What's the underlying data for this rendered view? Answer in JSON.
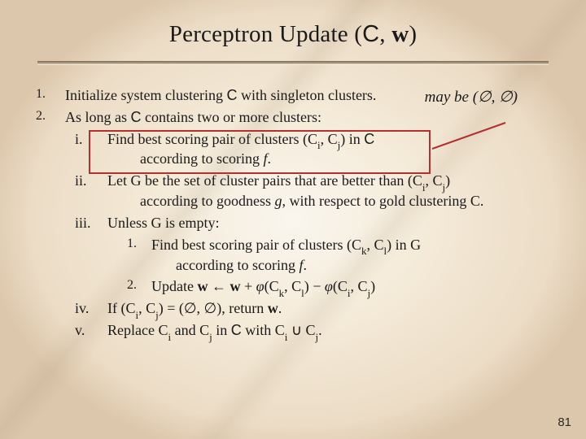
{
  "title_parts": {
    "pre": "Perceptron Update (",
    "C": "C",
    "mid": ", ",
    "w": "w",
    "post": ")"
  },
  "callout": "may be (∅, ∅)",
  "list": {
    "n1": "1.",
    "n2": "2.",
    "item1_a": "Initialize system clustering ",
    "item1_C": "C",
    "item1_b": " with singleton clusters.",
    "item2_a": "As long as ",
    "item2_C": "C",
    "item2_b": " contains two or more clusters:",
    "ri": "i.",
    "rii": "ii.",
    "riii": "iii.",
    "riv": "iv.",
    "rv": "v.",
    "i_a": "Find best scoring pair of clusters (C",
    "i_sub_i": "i",
    "i_mid": ", C",
    "i_sub_j": "j",
    "i_b": ") in ",
    "i_C": "C",
    "i_cont_a": "according to scoring ",
    "i_cont_f": "f",
    "i_cont_b": ".",
    "ii_a": "Let G be the set of cluster pairs that are better than (C",
    "ii_sub_i": "i",
    "ii_mid": ", C",
    "ii_sub_j": "j",
    "ii_b": ")",
    "ii_cont_a": "according to goodness ",
    "ii_cont_g": "g",
    "ii_cont_b": ", with respect to gold clustering C.",
    "iii_a": "Unless G is empty:",
    "in1": "1.",
    "in2": "2.",
    "iii1_a": "Find best scoring pair of clusters (C",
    "iii1_sub_k": "k",
    "iii1_mid": ", C",
    "iii1_sub_l": "l",
    "iii1_b": ") in G",
    "iii1_cont_a": "according to scoring ",
    "iii1_cont_f": "f",
    "iii1_cont_b": ".",
    "iii2_a": "Update ",
    "iii2_w1": "w",
    "iii2_arrow": " ← ",
    "iii2_w2": "w",
    "iii2_plus": " + ",
    "iii2_phi1": "φ",
    "iii2_p1a": "(C",
    "iii2_sub_k": "k",
    "iii2_p1m": ", C",
    "iii2_sub_l": "l",
    "iii2_p1b": ") − ",
    "iii2_phi2": "φ",
    "iii2_p2a": "(C",
    "iii2_sub_i": "i",
    "iii2_p2m": ", C",
    "iii2_sub_j": "j",
    "iii2_p2b": ")",
    "iv_a": "If  (C",
    "iv_sub_i": "i",
    "iv_mid": ", C",
    "iv_sub_j": "j",
    "iv_b": ") = (∅, ∅), return ",
    "iv_w": "w",
    "iv_c": ".",
    "v_a": "Replace C",
    "v_sub_i": "i",
    "v_mid": " and C",
    "v_sub_j": "j",
    "v_in": " in ",
    "v_C": "C",
    "v_with": " with C",
    "v_sub_i2": "i",
    "v_cup": " ∪ C",
    "v_sub_j2": "j",
    "v_end": "."
  },
  "page": "81"
}
